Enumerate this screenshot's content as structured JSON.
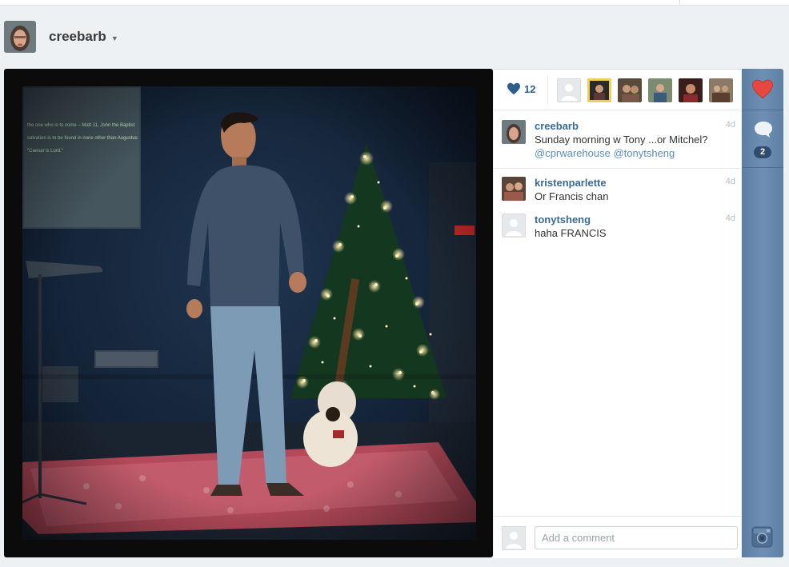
{
  "owner": {
    "username": "creebarb"
  },
  "post": {
    "like_count": "12",
    "caption": {
      "user": "creebarb",
      "age": "4d",
      "text": "Sunday morning w Tony ...or Mitchel?",
      "mentions": "@cprwarehouse @tonytsheng"
    },
    "comments": [
      {
        "user": "kristenparlette",
        "age": "4d",
        "text": "Or Francis chan"
      },
      {
        "user": "tonytsheng",
        "age": "4d",
        "text": "haha FRANCIS"
      }
    ],
    "comment_count": "2"
  },
  "comment_input": {
    "placeholder": "Add a comment"
  },
  "colors": {
    "link": "#3b6a95",
    "mention": "#5a8fbc",
    "heart": "#e8473f",
    "rail": "#6a8bb0",
    "like_heart": "#2d5f8a"
  }
}
